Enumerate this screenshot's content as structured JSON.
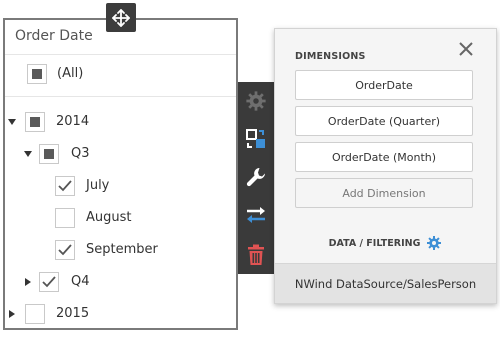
{
  "filter": {
    "title": "Order Date",
    "all_label": "(All)",
    "rows": {
      "y2014": "2014",
      "q3": "Q3",
      "july": "July",
      "august": "August",
      "september": "September",
      "q4": "Q4",
      "y2015": "2015"
    }
  },
  "toolbar": {
    "icons": [
      "gear-icon",
      "convert-icon",
      "wrench-icon",
      "swap-icon",
      "trash-icon"
    ],
    "delete_color": "#e05353"
  },
  "dimensions": {
    "header": "DIMENSIONS",
    "items": [
      "OrderDate",
      "OrderDate (Quarter)",
      "OrderDate (Month)"
    ],
    "add_label": "Add Dimension",
    "section_label": "DATA / FILTERING",
    "datasource": "NWind DataSource/SalesPerson"
  },
  "colors": {
    "accent_blue": "#3d8fd6",
    "toolbar_bg": "#3a3a3a"
  }
}
